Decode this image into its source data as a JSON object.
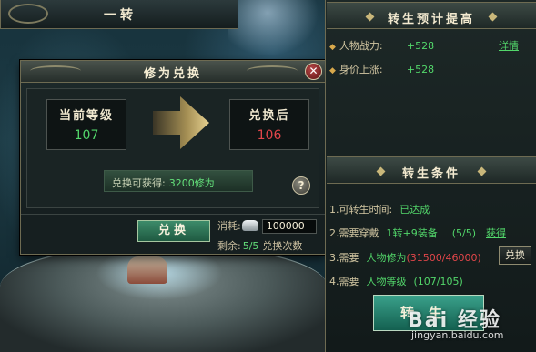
{
  "banner": {
    "title": "一转"
  },
  "dialog": {
    "title": "修为兑换",
    "close_icon": "close-icon",
    "current_label": "当前等级",
    "current_value": "107",
    "after_label": "兑换后",
    "after_value": "106",
    "gain_label": "兑换可获得:",
    "gain_value": "3200修为",
    "help_label": "?",
    "exchange_button": "兑换",
    "cost_label": "消耗:",
    "cost_icon": "silver-ingot-icon",
    "cost_value": "100000",
    "remain_label": "剩余:",
    "remain_value": "5/5",
    "remain_suffix": "兑换次数"
  },
  "panel": {
    "preview_title": "转生预计提高",
    "stats": [
      {
        "label": "人物战力:",
        "value": "+528",
        "link": "详情"
      },
      {
        "label": "身价上涨:",
        "value": "+528"
      }
    ],
    "conditions_title": "转生条件",
    "cond1": {
      "text": "1.可转生时间:",
      "value": "已达成"
    },
    "cond2": {
      "text": "2.需要穿戴",
      "value": "1转+9装备",
      "count": "(5/5)",
      "link": "获得"
    },
    "cond3": {
      "text": "3.需要",
      "name": "人物修为",
      "value": "(31500/46000)",
      "button": "兑换"
    },
    "cond4": {
      "text": "4.需要",
      "name": "人物等级",
      "value": "(107/105)"
    },
    "zhuan_button": "转生"
  },
  "watermark": {
    "brand": "Bai 经验",
    "url": "jingyan.baidu.com"
  },
  "colors": {
    "positive": "#52d66a",
    "negative": "#e2464a",
    "gold": "#c9b77a"
  }
}
